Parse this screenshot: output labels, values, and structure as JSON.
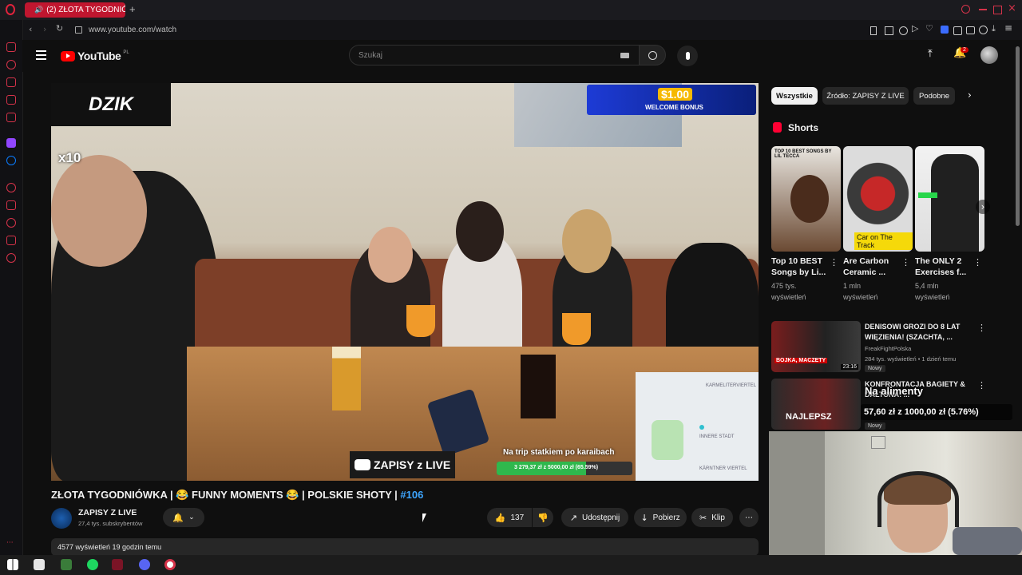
{
  "browser": {
    "tab_title": "(2) ZŁOTA TYGODNIÓ",
    "url": "www.youtube.com/watch"
  },
  "youtube": {
    "logo": "YouTube",
    "region": "PL",
    "search_placeholder": "Szukaj",
    "notifications_count": "2"
  },
  "video": {
    "overlay_brand": "DZIK",
    "overlay_multiplier": "x10",
    "bonus_amount": "$1.00",
    "bonus_label": "WELCOME BONUS",
    "channel_watermark": "ZAPISY z LIVE",
    "goal_label": "Na trip statkiem po karaibach",
    "goal_progress": "3 279,37 zł z 5000,00 zł (65.59%)",
    "goal_fraction": 0.6559,
    "map_labels": [
      "KARMELITERVIERTEL",
      "INNERE STADT",
      "KÄRNTNER VIERTEL"
    ]
  },
  "info": {
    "title_main": "ZŁOTA TYGODNIÓWKA | 😂 FUNNY MOMENTS 😂 | POLSKIE SHOTY | ",
    "title_hashtag": "#106",
    "channel_name": "ZAPISY Z LIVE",
    "subscribers": "27,4 tys. subskrybentów",
    "likes": "137",
    "share_label": "Udostępnij",
    "download_label": "Pobierz",
    "clip_label": "Klip",
    "views_line": "4577 wyświetleń  19 godzin temu"
  },
  "sidebar": {
    "chips": [
      "Wszystkie",
      "Źródło: ZAPISY Z LIVE",
      "Podobne"
    ],
    "shorts_heading": "Shorts",
    "shorts": [
      {
        "title": "Top 10 BEST Songs by Li...",
        "views": "475 tys. wyświetleń",
        "thumb_text": "TOP 10 BEST SONGS BY LIL TECCA"
      },
      {
        "title": "Are Carbon Ceramic ...",
        "views": "1 mln wyświetleń",
        "thumb_text": "Car on The Track"
      },
      {
        "title": "The ONLY 2 Exercises f...",
        "views": "5,4 mln wyświetleń",
        "thumb_text": ""
      }
    ],
    "videos": [
      {
        "title": "DENISOWI GROZI DO 8 LAT WIĘZIENIA! (SZACHTA, ...",
        "channel": "FreakFightPolska",
        "meta": "284 tys. wyświetleń • 1 dzień temu",
        "badge": "Nowy",
        "duration": "23:16",
        "thumb_text": "BOJKA, MACZETY"
      },
      {
        "title": "KONFRONTACJA BAGIETY & DALTONA: ...",
        "channel": "",
        "meta": "",
        "badge": "Nowy",
        "duration": "",
        "thumb_text": "NAJLEPSZ"
      }
    ]
  },
  "stream_overlay": {
    "title": "Na alimenty",
    "progress": "57,60 zł z 1000,00 zł (5.76%)"
  },
  "colors": {
    "youtube_red": "#ff0000",
    "opera_red": "#c0162f",
    "background": "#0f0f0f",
    "hashtag_blue": "#3ea6ff",
    "overlay_green": "#22c55e"
  }
}
